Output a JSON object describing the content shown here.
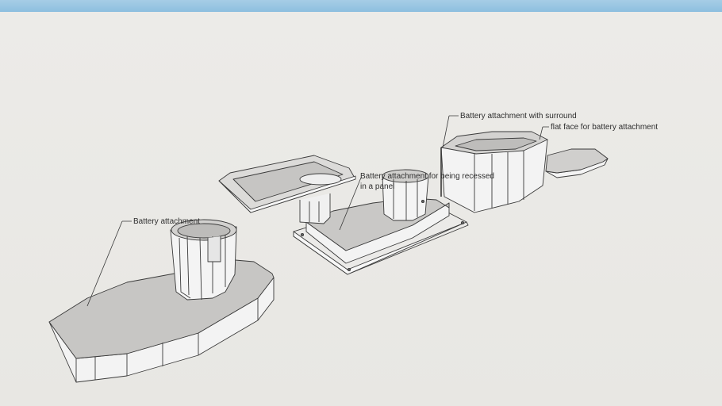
{
  "colors": {
    "sky": "#8dbfdf",
    "ground": "#e9e8e4",
    "model_face": "#c9c8c6",
    "model_side": "#f2f2f2",
    "edge": "#3a3a3a"
  },
  "annotations": {
    "battery_attachment": "Battery attachment",
    "recessed_panel": "Battery attachment for being recessed in a panel",
    "with_surround": "Battery attachment with surround",
    "flat_face": "flat face for battery attachment"
  }
}
